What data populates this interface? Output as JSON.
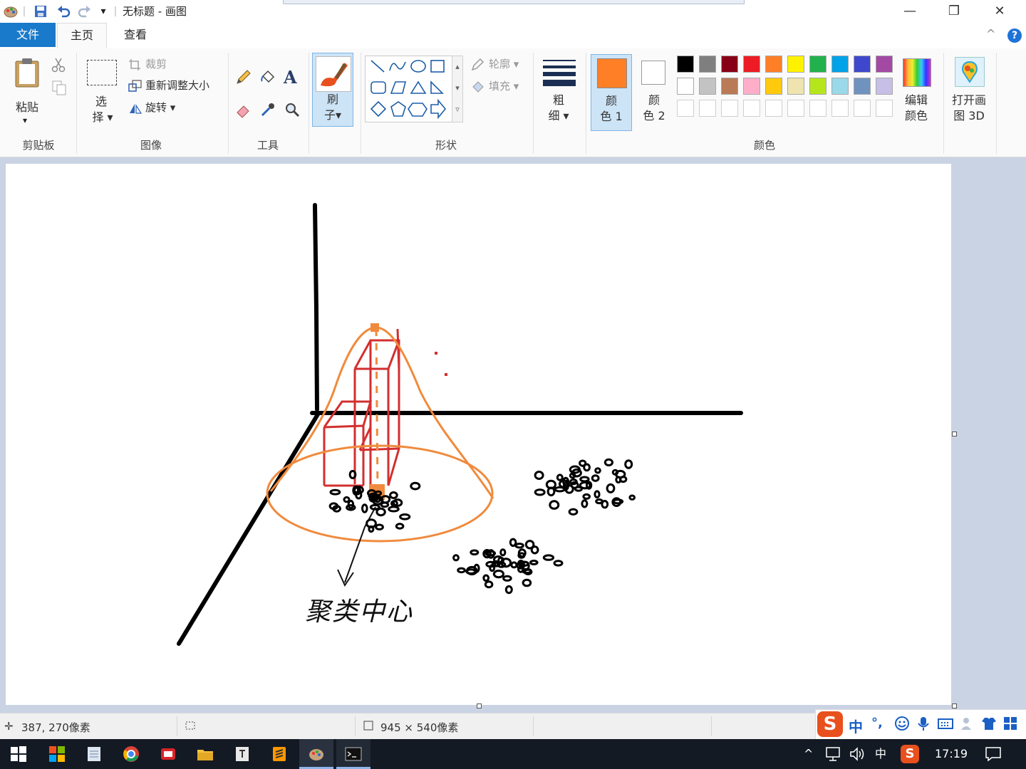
{
  "window": {
    "title": "无标题 - 画图",
    "quick_access": {
      "separator": "|",
      "dropdown": "▾"
    },
    "controls": {
      "minimize": "—",
      "restore": "❐",
      "close": "✕"
    }
  },
  "menu": {
    "tabs": [
      "文件",
      "主页",
      "查看"
    ],
    "collapse": "^",
    "help": "?"
  },
  "ribbon": {
    "clipboard": {
      "paste": "粘贴",
      "paste_arrow": "▾",
      "group": "剪贴板"
    },
    "image": {
      "select_1": "选",
      "select_2": "择 ▾",
      "crop": "裁剪",
      "resize": "重新调整大小",
      "rotate": "旋转 ▾",
      "group": "图像"
    },
    "tools": {
      "text_glyph": "A",
      "group": "工具"
    },
    "brushes": {
      "label_1": "刷",
      "label_2": "子▾"
    },
    "shapes": {
      "outline": "轮廓 ▾",
      "fill": "填充 ▾",
      "group": "形状"
    },
    "size": {
      "label_1": "粗",
      "label_2": "细 ▾"
    },
    "colors": {
      "color1_1": "颜",
      "color1_2": "色 1",
      "color2_1": "颜",
      "color2_2": "色 2",
      "edit_1": "编辑",
      "edit_2": "颜色",
      "group": "颜色",
      "color1_value": "#ff7f27",
      "color2_value": "#ffffff",
      "palette_row1": [
        "#000000",
        "#7f7f7f",
        "#880015",
        "#ed1c24",
        "#ff7f27",
        "#fff200",
        "#22b14c",
        "#00a2e8",
        "#3f48cc",
        "#a349a4"
      ],
      "palette_row2": [
        "#ffffff",
        "#c3c3c3",
        "#b97a57",
        "#ffaec9",
        "#ffc90e",
        "#efe4b0",
        "#b5e61d",
        "#99d9ea",
        "#7092be",
        "#c8bfe7"
      ]
    },
    "paint3d": {
      "label_1": "打开画",
      "label_2": "图 3D"
    }
  },
  "canvas": {
    "annotation": "聚类中心"
  },
  "status": {
    "cursor_pos": "387, 270像素",
    "canvas_size": "945 × 540像素"
  },
  "ime": {
    "mode": "中",
    "punct": "°,"
  },
  "tray": {
    "arrow": "^",
    "lang": "中",
    "time": "17:19"
  }
}
